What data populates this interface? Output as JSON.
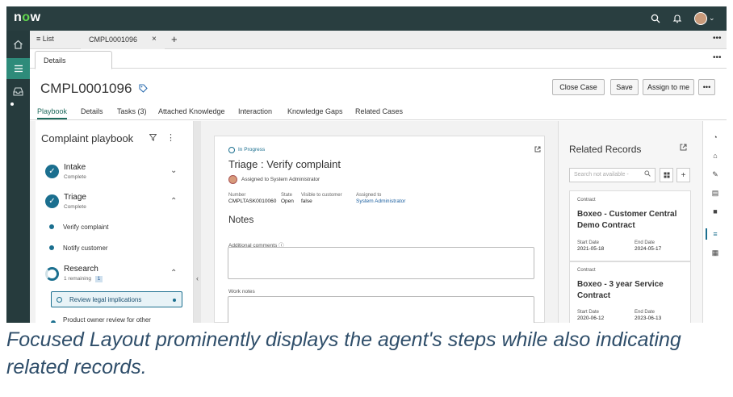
{
  "topbar": {
    "logo_text": "now",
    "logo_dot_color": "#62d84e",
    "search_icon": "search-icon",
    "bell_icon": "bell-icon",
    "caret": "⌄"
  },
  "tabs": {
    "list_label": "≡ List",
    "record_tab": "CMPL0001096",
    "close": "×",
    "add": "+",
    "more": "•••"
  },
  "subtab": {
    "label": "Details",
    "more": "•••"
  },
  "record": {
    "number": "CMPL0001096"
  },
  "actions": {
    "close_case": "Close Case",
    "save": "Save",
    "assign_to_me": "Assign to me",
    "more": "•••"
  },
  "nav_tabs": [
    "Playbook",
    "Details",
    "Tasks (3)",
    "Attached Knowledge",
    "Interaction",
    "Knowledge Gaps",
    "Related Cases"
  ],
  "playbook": {
    "title": "Complaint playbook",
    "stages": [
      {
        "name": "Intake",
        "status": "Complete"
      },
      {
        "name": "Triage",
        "status": "Complete"
      },
      {
        "name": "Research",
        "status": "1 remaining",
        "badge": "1"
      }
    ],
    "triage_steps": [
      "Verify complaint",
      "Notify customer"
    ],
    "research_steps": [
      "Review legal implications",
      "Product owner review for other"
    ]
  },
  "task": {
    "status": "In Progress",
    "title": "Triage : Verify complaint",
    "assigned_line": "Assigned to System Administrator",
    "fields": [
      {
        "key": "Number",
        "value": "CMPLTASK0010060"
      },
      {
        "key": "State",
        "value": "Open"
      },
      {
        "key": "Visible to customer",
        "value": "false"
      },
      {
        "key": "Assigned to",
        "value": "System Administrator"
      }
    ],
    "notes_title": "Notes",
    "additional_comments_label": "Additional comments ⓘ",
    "work_notes_label": "Work notes"
  },
  "related": {
    "title": "Related Records",
    "search_placeholder": "Search not available -",
    "records": [
      {
        "type": "Contract",
        "name": "Boxeo - Customer Central Demo Contract",
        "start_label": "Start Date",
        "start": "2021-05-18",
        "end_label": "End Date",
        "end": "2024-05-17"
      },
      {
        "type": "Contract",
        "name": "Boxeo - 3 year Service Contract",
        "start_label": "Start Date",
        "start": "2020-06-12",
        "end_label": "End Date",
        "end": "2023-06-13"
      }
    ]
  },
  "colors": {
    "header": "#293e40",
    "accent": "#1b6f8f",
    "caption": "#2f4e6a"
  },
  "caption": "Focused Layout prominently displays the agent's steps while also indicating related records."
}
